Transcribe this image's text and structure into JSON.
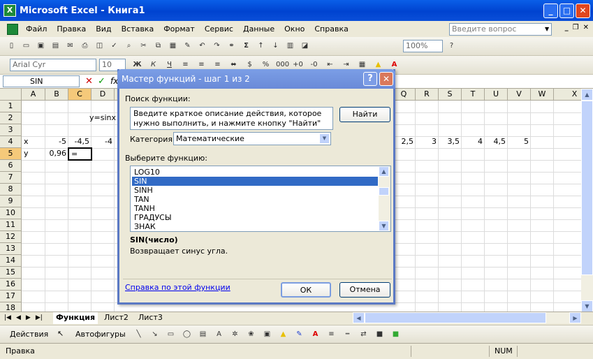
{
  "window": {
    "title": "Microsoft Excel - Книга1",
    "app_icon": "X"
  },
  "menu": {
    "items": [
      "Файл",
      "Правка",
      "Вид",
      "Вставка",
      "Формат",
      "Сервис",
      "Данные",
      "Окно",
      "Справка"
    ],
    "ask_placeholder": "Введите вопрос"
  },
  "toolbar": {
    "zoom": "100%",
    "font": "Arial Cyr",
    "size": "10"
  },
  "formula_bar": {
    "name_box": "SIN",
    "fx": "fx"
  },
  "columns": [
    "A",
    "B",
    "C",
    "D",
    "Q",
    "R",
    "S",
    "T",
    "U",
    "V",
    "W",
    "X"
  ],
  "rows": [
    "1",
    "2",
    "3",
    "4",
    "5",
    "6",
    "7",
    "8",
    "9",
    "10",
    "11",
    "12",
    "13",
    "14",
    "15",
    "16",
    "17",
    "18"
  ],
  "cells": {
    "c2": "y=sinx",
    "a4": "x",
    "b4": "-5",
    "c4": "-4,5",
    "d4": "-4",
    "q4": "2,5",
    "r4": "3",
    "s4": "3,5",
    "t4": "4",
    "u4": "4,5",
    "v4": "5",
    "a5": "y",
    "b5": "0,96",
    "c5": "="
  },
  "sheets": {
    "tabs": [
      "Функция",
      "Лист2",
      "Лист3"
    ]
  },
  "drawing": {
    "actions": "Действия",
    "autoshapes": "Автофигуры"
  },
  "status": {
    "mode": "Правка",
    "num": "NUM"
  },
  "dialog": {
    "title": "Мастер функций - шаг 1 из 2",
    "search_label": "Поиск функции:",
    "search_text": "Введите краткое описание действия, которое нужно выполнить, и нажмите кнопку \"Найти\"",
    "find_button": "Найти",
    "category_label": "Категория:",
    "category_value": "Математические",
    "choose_label": "Выберите функцию:",
    "functions": [
      "LOG10",
      "SIN",
      "SINH",
      "TAN",
      "TANH",
      "ГРАДУСЫ",
      "ЗНАК"
    ],
    "selected_function": "SIN",
    "signature": "SIN(число)",
    "description": "Возвращает синус угла.",
    "help_link": "Справка по этой функции",
    "ok": "ОК",
    "cancel": "Отмена"
  }
}
